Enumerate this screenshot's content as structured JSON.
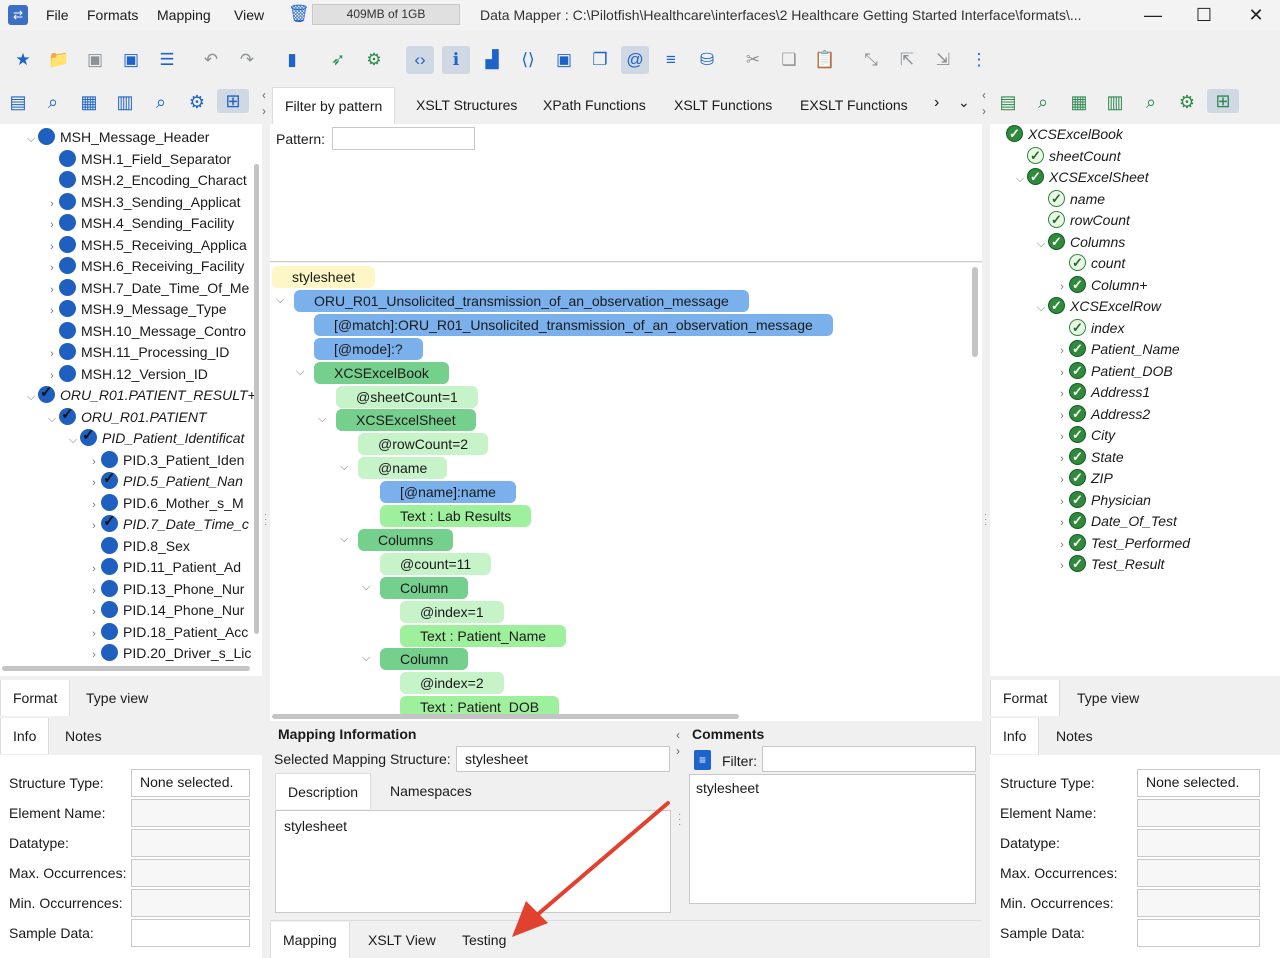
{
  "menu": {
    "file": "File",
    "formats": "Formats",
    "mapping": "Mapping",
    "view": "View"
  },
  "memory": "409MB of 1GB",
  "window_title": "Data Mapper : C:\\Pilotfish\\Healthcare\\interfaces\\2 Healthcare Getting Started Interface\\formats\\...",
  "left_tree": [
    {
      "label": "MSH_Message_Header",
      "indent": 0,
      "mark": "dot",
      "arrow": "down"
    },
    {
      "label": "MSH.1_Field_Separator",
      "indent": 1,
      "mark": "dot",
      "arrow": ""
    },
    {
      "label": "MSH.2_Encoding_Charact",
      "indent": 1,
      "mark": "dot",
      "arrow": ""
    },
    {
      "label": "MSH.3_Sending_Applicat",
      "indent": 1,
      "mark": "dot",
      "arrow": "right"
    },
    {
      "label": "MSH.4_Sending_Facility",
      "indent": 1,
      "mark": "dot",
      "arrow": "right"
    },
    {
      "label": "MSH.5_Receiving_Applica",
      "indent": 1,
      "mark": "dot",
      "arrow": "right"
    },
    {
      "label": "MSH.6_Receiving_Facility",
      "indent": 1,
      "mark": "dot",
      "arrow": "right"
    },
    {
      "label": "MSH.7_Date_Time_Of_Me",
      "indent": 1,
      "mark": "dot",
      "arrow": "right"
    },
    {
      "label": "MSH.9_Message_Type",
      "indent": 1,
      "mark": "dot",
      "arrow": "right"
    },
    {
      "label": "MSH.10_Message_Contro",
      "indent": 1,
      "mark": "dot",
      "arrow": ""
    },
    {
      "label": "MSH.11_Processing_ID",
      "indent": 1,
      "mark": "dot",
      "arrow": "right"
    },
    {
      "label": "MSH.12_Version_ID",
      "indent": 1,
      "mark": "dot",
      "arrow": "right"
    },
    {
      "label": "ORU_R01.PATIENT_RESULT+",
      "indent": 0,
      "mark": "bchk",
      "arrow": "down",
      "italic": true
    },
    {
      "label": "ORU_R01.PATIENT",
      "indent": 1,
      "mark": "bchk",
      "arrow": "down",
      "italic": true
    },
    {
      "label": "PID_Patient_Identificat",
      "indent": 2,
      "mark": "bchk",
      "arrow": "down",
      "italic": true
    },
    {
      "label": "PID.3_Patient_Iden",
      "indent": 3,
      "mark": "dot",
      "arrow": "right"
    },
    {
      "label": "PID.5_Patient_Nan",
      "indent": 3,
      "mark": "bchk",
      "arrow": "right",
      "italic": true
    },
    {
      "label": "PID.6_Mother_s_M",
      "indent": 3,
      "mark": "dot",
      "arrow": "right"
    },
    {
      "label": "PID.7_Date_Time_c",
      "indent": 3,
      "mark": "bchk",
      "arrow": "right",
      "italic": true
    },
    {
      "label": "PID.8_Sex",
      "indent": 3,
      "mark": "dot",
      "arrow": ""
    },
    {
      "label": "PID.11_Patient_Ad",
      "indent": 3,
      "mark": "dot",
      "arrow": "right"
    },
    {
      "label": "PID.13_Phone_Nur",
      "indent": 3,
      "mark": "dot",
      "arrow": "right"
    },
    {
      "label": "PID.14_Phone_Nur",
      "indent": 3,
      "mark": "dot",
      "arrow": "right"
    },
    {
      "label": "PID.18_Patient_Acc",
      "indent": 3,
      "mark": "dot",
      "arrow": "right"
    },
    {
      "label": "PID.20_Driver_s_Lic",
      "indent": 3,
      "mark": "dot",
      "arrow": "right"
    }
  ],
  "right_tree": [
    {
      "label": "XCSExcelBook",
      "indent": 0,
      "mark": "chk",
      "arrow": ""
    },
    {
      "label": "sheetCount",
      "indent": 1,
      "mark": "lite",
      "arrow": ""
    },
    {
      "label": "XCSExcelSheet",
      "indent": 1,
      "mark": "chk",
      "arrow": "down"
    },
    {
      "label": "name",
      "indent": 2,
      "mark": "lite",
      "arrow": ""
    },
    {
      "label": "rowCount",
      "indent": 2,
      "mark": "lite",
      "arrow": ""
    },
    {
      "label": "Columns",
      "indent": 2,
      "mark": "chk",
      "arrow": "down"
    },
    {
      "label": "count",
      "indent": 3,
      "mark": "lite",
      "arrow": ""
    },
    {
      "label": "Column+",
      "indent": 3,
      "mark": "chk",
      "arrow": "right"
    },
    {
      "label": "XCSExcelRow",
      "indent": 2,
      "mark": "chk",
      "arrow": "down"
    },
    {
      "label": "index",
      "indent": 3,
      "mark": "lite",
      "arrow": ""
    },
    {
      "label": "Patient_Name",
      "indent": 3,
      "mark": "chk",
      "arrow": "right"
    },
    {
      "label": "Patient_DOB",
      "indent": 3,
      "mark": "chk",
      "arrow": "right"
    },
    {
      "label": "Address1",
      "indent": 3,
      "mark": "chk",
      "arrow": "right"
    },
    {
      "label": "Address2",
      "indent": 3,
      "mark": "chk",
      "arrow": "right"
    },
    {
      "label": "City",
      "indent": 3,
      "mark": "chk",
      "arrow": "right"
    },
    {
      "label": "State",
      "indent": 3,
      "mark": "chk",
      "arrow": "right"
    },
    {
      "label": "ZIP",
      "indent": 3,
      "mark": "chk",
      "arrow": "right"
    },
    {
      "label": "Physician",
      "indent": 3,
      "mark": "chk",
      "arrow": "right"
    },
    {
      "label": "Date_Of_Test",
      "indent": 3,
      "mark": "chk",
      "arrow": "right"
    },
    {
      "label": "Test_Performed",
      "indent": 3,
      "mark": "chk",
      "arrow": "right"
    },
    {
      "label": "Test_Result",
      "indent": 3,
      "mark": "chk",
      "arrow": "right"
    }
  ],
  "center_tabs": [
    "Filter by pattern",
    "XSLT Structures",
    "XPath Functions",
    "XSLT Functions",
    "EXSLT Functions"
  ],
  "pattern_label": "Pattern:",
  "pattern_value": "",
  "mapping_nodes": [
    {
      "label": "stylesheet",
      "color": "y",
      "arrow": ""
    },
    {
      "label": "ORU_R01_Unsolicited_transmission_of_an_observation_message",
      "color": "b",
      "arrow": "down"
    },
    {
      "label": "[@match]:ORU_R01_Unsolicited_transmission_of_an_observation_message",
      "color": "b",
      "arrow": ""
    },
    {
      "label": "[@mode]:?",
      "color": "b",
      "arrow": ""
    },
    {
      "label": "XCSExcelBook",
      "color": "g",
      "arrow": "down"
    },
    {
      "label": "@sheetCount=1",
      "color": "lg",
      "arrow": ""
    },
    {
      "label": "XCSExcelSheet",
      "color": "g",
      "arrow": "down"
    },
    {
      "label": "@rowCount=2",
      "color": "lg",
      "arrow": ""
    },
    {
      "label": "@name",
      "color": "lg",
      "arrow": "down"
    },
    {
      "label": "[@name]:name",
      "color": "b",
      "arrow": ""
    },
    {
      "label": "Text : Lab Results",
      "color": "l",
      "arrow": ""
    },
    {
      "label": "Columns",
      "color": "g",
      "arrow": "down"
    },
    {
      "label": "@count=11",
      "color": "lg",
      "arrow": ""
    },
    {
      "label": "Column",
      "color": "g",
      "arrow": "down"
    },
    {
      "label": "@index=1",
      "color": "lg",
      "arrow": ""
    },
    {
      "label": "Text : Patient_Name",
      "color": "l",
      "arrow": ""
    },
    {
      "label": "Column",
      "color": "g",
      "arrow": "down"
    },
    {
      "label": "@index=2",
      "color": "lg",
      "arrow": ""
    },
    {
      "label": "Text : Patient_DOB",
      "color": "l",
      "arrow": ""
    }
  ],
  "left_bottom_tabs": {
    "format": "Format",
    "type_view": "Type view",
    "info": "Info",
    "notes": "Notes"
  },
  "props": {
    "structure_type": "Structure Type:",
    "structure_type_value": "None selected.",
    "element_name": "Element Name:",
    "datatype": "Datatype:",
    "max_occ": "Max. Occurrences:",
    "min_occ": "Min. Occurrences:",
    "sample": "Sample Data:"
  },
  "mapping_info": {
    "title": "Mapping Information",
    "selected_label": "Selected Mapping Structure:",
    "selected_value": "stylesheet",
    "tab_description": "Description",
    "tab_namespaces": "Namespaces",
    "description_text": "stylesheet"
  },
  "comments": {
    "title": "Comments",
    "filter_label": "Filter:",
    "text": "stylesheet"
  },
  "bottom_tabs": {
    "mapping": "Mapping",
    "xslt_view": "XSLT View",
    "testing": "Testing"
  },
  "colors": {
    "accent_blue": "#1e63c9",
    "node_blue": "#7ab0ec",
    "node_green": "#75cf8d",
    "arrow_red": "#e2412f"
  }
}
